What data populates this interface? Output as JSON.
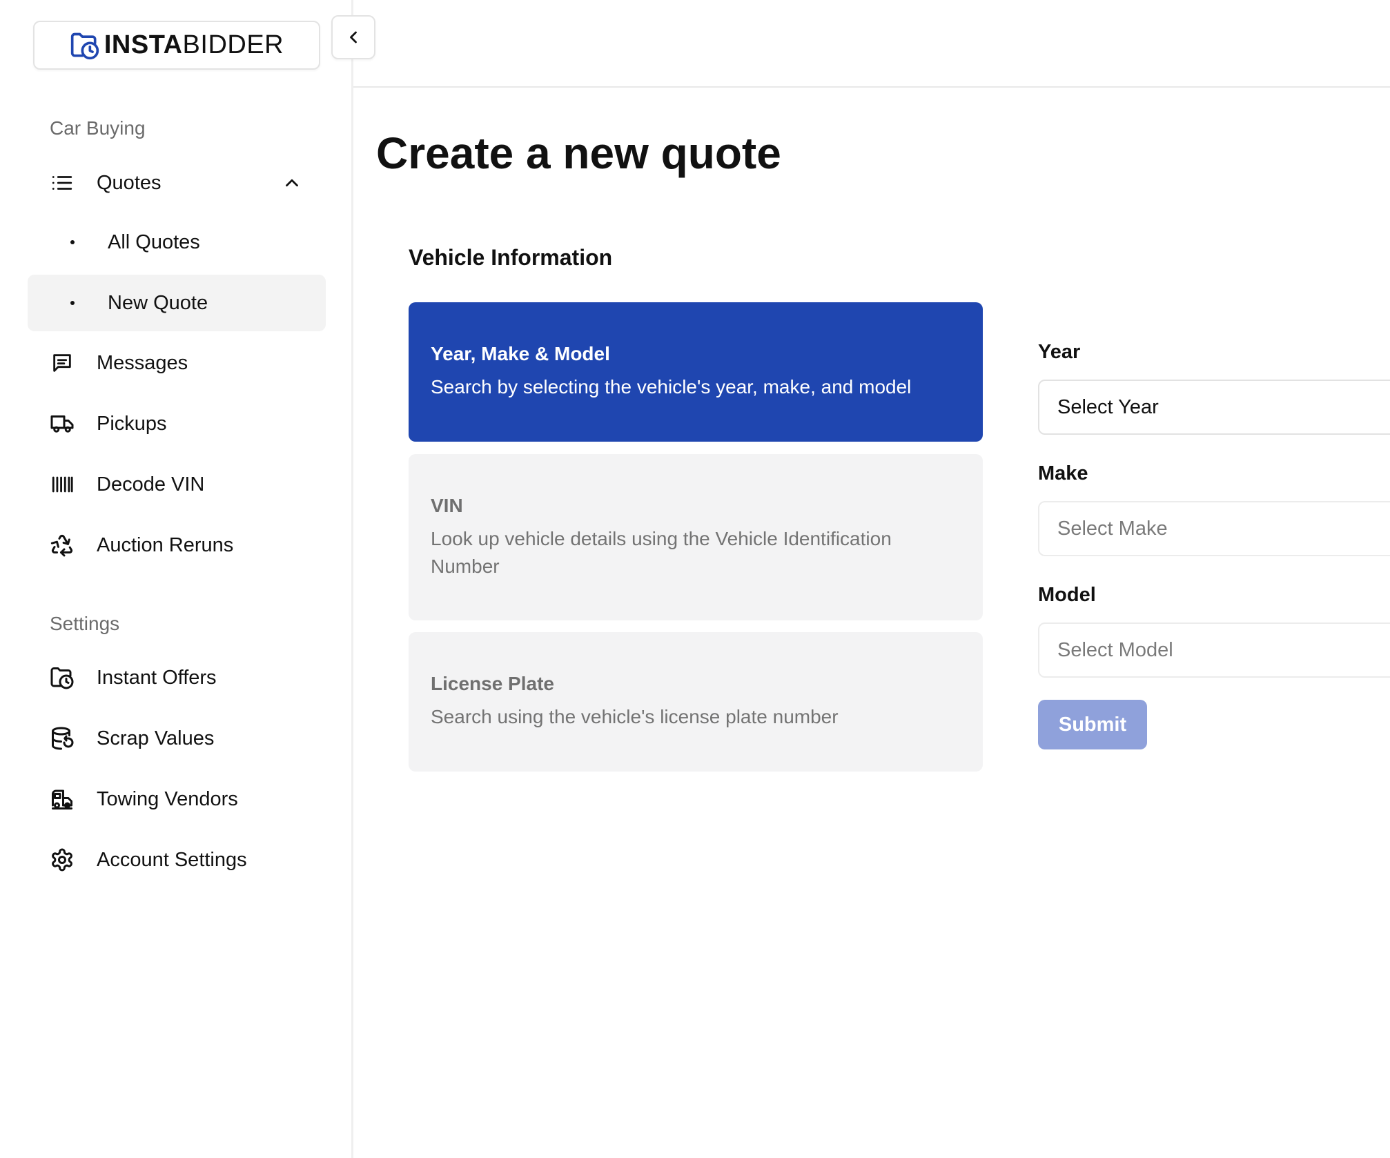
{
  "brand": {
    "logo_bold": "INSTA",
    "logo_light": "BIDDER",
    "accent": "#1f46b0"
  },
  "sidebar": {
    "sections": [
      {
        "label": "Car Buying"
      },
      {
        "label": "Settings"
      }
    ],
    "items": [
      {
        "label": "Quotes",
        "icon": "list-icon",
        "expanded": true
      },
      {
        "label": "All Quotes"
      },
      {
        "label": "New Quote",
        "active": true
      },
      {
        "label": "Messages",
        "icon": "message-icon"
      },
      {
        "label": "Pickups",
        "icon": "truck-icon"
      },
      {
        "label": "Decode VIN",
        "icon": "barcode-icon"
      },
      {
        "label": "Auction Reruns",
        "icon": "recycle-icon"
      },
      {
        "label": "Instant Offers",
        "icon": "folder-clock-icon"
      },
      {
        "label": "Scrap Values",
        "icon": "database-icon"
      },
      {
        "label": "Towing Vendors",
        "icon": "tow-truck-icon"
      },
      {
        "label": "Account Settings",
        "icon": "gear-icon"
      }
    ]
  },
  "main": {
    "title": "Create a new quote",
    "section_title": "Vehicle Information",
    "options": [
      {
        "title": "Year, Make & Model",
        "desc": "Search by selecting the vehicle's year, make, and model",
        "selected": true
      },
      {
        "title": "VIN",
        "desc": "Look up vehicle details using the Vehicle Identification Number",
        "selected": false
      },
      {
        "title": "License Plate",
        "desc": "Search using the vehicle's license plate number",
        "selected": false
      }
    ],
    "form": {
      "year_label": "Year",
      "year_value": "Select Year",
      "make_label": "Make",
      "make_value": "Select Make",
      "model_label": "Model",
      "model_value": "Select Model",
      "submit_label": "Submit"
    }
  }
}
